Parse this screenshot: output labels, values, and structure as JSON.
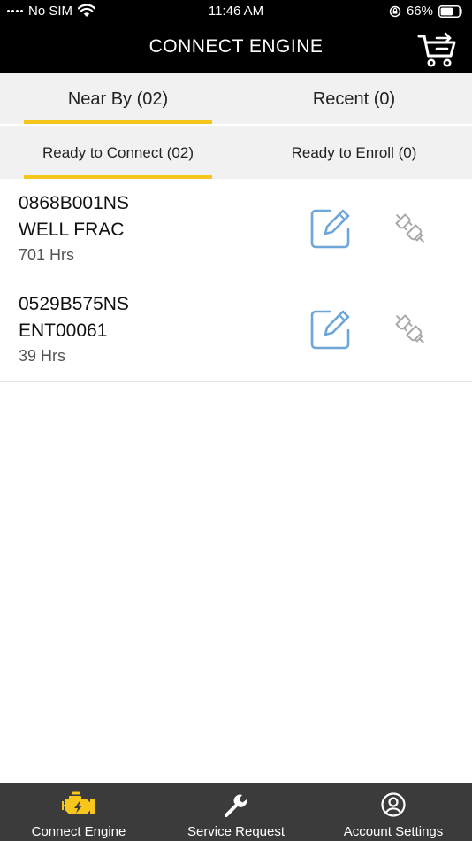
{
  "status_bar": {
    "carrier": "No SIM",
    "time": "11:46 AM",
    "battery": "66%"
  },
  "header": {
    "title": "CONNECT ENGINE"
  },
  "tabs": [
    {
      "label": "Near By (02)",
      "selected": true
    },
    {
      "label": "Recent (0)",
      "selected": false
    }
  ],
  "subtabs": [
    {
      "label": "Ready to Connect (02)",
      "selected": true
    },
    {
      "label": "Ready to Enroll (0)",
      "selected": false
    }
  ],
  "engines": [
    {
      "serial": "0868B001NS",
      "name": "WELL FRAC",
      "hours": "701 Hrs"
    },
    {
      "serial": "0529B575NS",
      "name": "ENT00061",
      "hours": "39 Hrs"
    }
  ],
  "bottom_nav": [
    {
      "label": "Connect Engine",
      "icon": "engine-icon",
      "selected": true
    },
    {
      "label": "Service Request",
      "icon": "wrench-icon",
      "selected": false
    },
    {
      "label": "Account Settings",
      "icon": "account-icon",
      "selected": false
    }
  ],
  "colors": {
    "accent": "#f7c61c",
    "header_bg": "#000000",
    "tab_bg": "#f1f1f1",
    "edit_icon": "#6fa6d8",
    "nav_bg": "#3b3b3b"
  }
}
